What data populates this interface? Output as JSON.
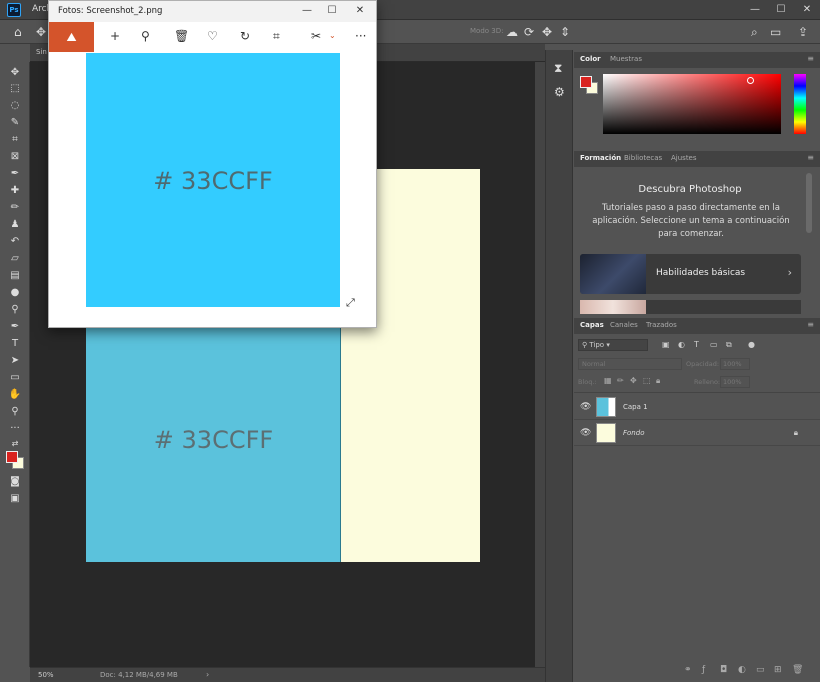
{
  "photoshop": {
    "logo": "Ps",
    "menu_first": "Arch",
    "window_controls": {
      "minimize": "—",
      "maximize": "☐",
      "close": "✕"
    },
    "options": {
      "home_icon": "home-icon",
      "mode_3d": "Modo 3D:"
    },
    "doc_tab": "Sin",
    "canvas": {
      "left_color": "#5bc2dc",
      "right_color": "#fcfcdd",
      "hex_label": "# 33CCFF"
    },
    "status": {
      "zoom": "50%",
      "doc_size": "Doc: 4,12 MB/4,69 MB",
      "arrow": "›"
    },
    "swatches": {
      "foreground": "#d9231f",
      "background": "#fcfcdc"
    }
  },
  "panels": {
    "color": {
      "tabs": [
        "Color",
        "Muestras"
      ],
      "active_tab": "Color"
    },
    "learn": {
      "tabs": [
        "Formación",
        "Bibliotecas",
        "Ajustes"
      ],
      "title": "Descubra Photoshop",
      "description": "Tutoriales paso a paso directamente en la aplicación. Seleccione un tema a continuación para comenzar.",
      "card_label": "Habilidades básicas"
    },
    "layers": {
      "tabs": [
        "Capas",
        "Canales",
        "Trazados"
      ],
      "filter_label": "Tipo",
      "blend_mode": "Normal",
      "opacity_label": "Opacidad:",
      "opacity_value": "100%",
      "lock_label": "Bloq.:",
      "fill_label": "Relleno:",
      "fill_value": "100%",
      "layers": [
        {
          "name": "Capa 1",
          "visible": true,
          "locked": false
        },
        {
          "name": "Fondo",
          "visible": true,
          "locked": true
        }
      ]
    }
  },
  "photos": {
    "title": "Fotos: Screenshot_2.png",
    "window_controls": {
      "minimize": "—",
      "maximize": "☐",
      "close": "✕"
    },
    "toolbar": [
      "add-icon",
      "zoom-icon",
      "delete-icon",
      "favorite-icon",
      "rotate-icon",
      "crop-icon",
      "edit-icon",
      "more-icon"
    ],
    "image_color": "#33ccff",
    "hex_label": "# 33CCFF",
    "more_label": "···"
  }
}
